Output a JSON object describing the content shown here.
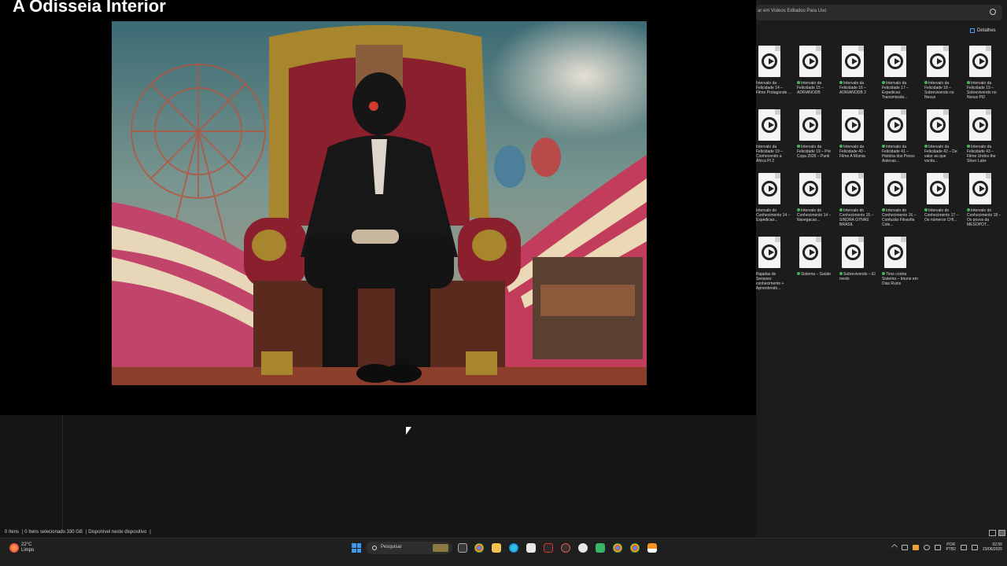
{
  "player": {
    "title": "A Odisseia Interior"
  },
  "explorer": {
    "search_placeholder": "ar em Vídeos Editados Para Uso",
    "details_label": "Detalhes",
    "files": [
      {
        "label": "Intervalo da Felicidade 14 – Filme Protagonde ...",
        "synced": false
      },
      {
        "label": "Intervalo da Felicidade 15 – ADRIANODB",
        "synced": true
      },
      {
        "label": "Intervalo da Felicidade 16 – ADRIANODB 2",
        "synced": true
      },
      {
        "label": "Intervalo da Felicidade 17 – Expedicao Transmissão...",
        "synced": true
      },
      {
        "label": "Intervalo da Felicidade 18 – Sobrevivendo no Nexus",
        "synced": true
      },
      {
        "label": "Intervalo da Felicidade 19 – Sobrevivendo no Nexus Pt2",
        "synced": true
      },
      {
        "label": "Intervalo da Felicidade 19 – Conhecendo a África Pt 2",
        "synced": false
      },
      {
        "label": "Intervalo da Felicidade 19 – Pré Copa 2026 – Punk",
        "synced": true
      },
      {
        "label": "Intervalo da Felicidade 40 – Filme A Múmia",
        "synced": true
      },
      {
        "label": "Intervalo da Felicidade 41 – História dos Povos Astecas...",
        "synced": true
      },
      {
        "label": "Intervalo da Felicidade 42 – De valor ao que vocês...",
        "synced": true
      },
      {
        "label": "Intervalo da Felicidade 43 – Filme Undos the Silver Lake",
        "synced": true
      },
      {
        "label": "Intervalo do Conhecimento 14 – Expedicao...",
        "synced": false
      },
      {
        "label": "Intervalo do Conhecimento 14 – Navegacao...",
        "synced": true
      },
      {
        "label": "Intervalo do Conhecimento 15 – SINDRA GYNAS BRASIL",
        "synced": true
      },
      {
        "label": "Intervalo do Conhecimento 16 – Confusão Filosofia Cole...",
        "synced": true
      },
      {
        "label": "Intervalo do Conhecimento 17 – Os números CHI...",
        "synced": true
      },
      {
        "label": "Intervalo do Conhecimento 18 – Os povos da MESOPOT...",
        "synced": true
      },
      {
        "label": "Rajadas de Sensoes conhecimento + Aprendendo...",
        "synced": false
      },
      {
        "label": "Sistema – Saúde",
        "synced": true
      },
      {
        "label": "Sobrevivendo – El medo",
        "synced": true
      },
      {
        "label": "Tiros contra Sistema – Imune em Dias Ruins",
        "synced": true
      }
    ]
  },
  "status_bar": {
    "items_count": "0 Itens",
    "selected": "0 Itens selecionado 330 GB",
    "availability": "Disponível neste dispositivo"
  },
  "taskbar": {
    "weather_temp": "22°C",
    "weather_cond": "Limpo",
    "search_label": "Pesquisar",
    "lang_1": "POR",
    "lang_2": "PTB2",
    "time": "02:55",
    "date": "23/06/2025"
  }
}
